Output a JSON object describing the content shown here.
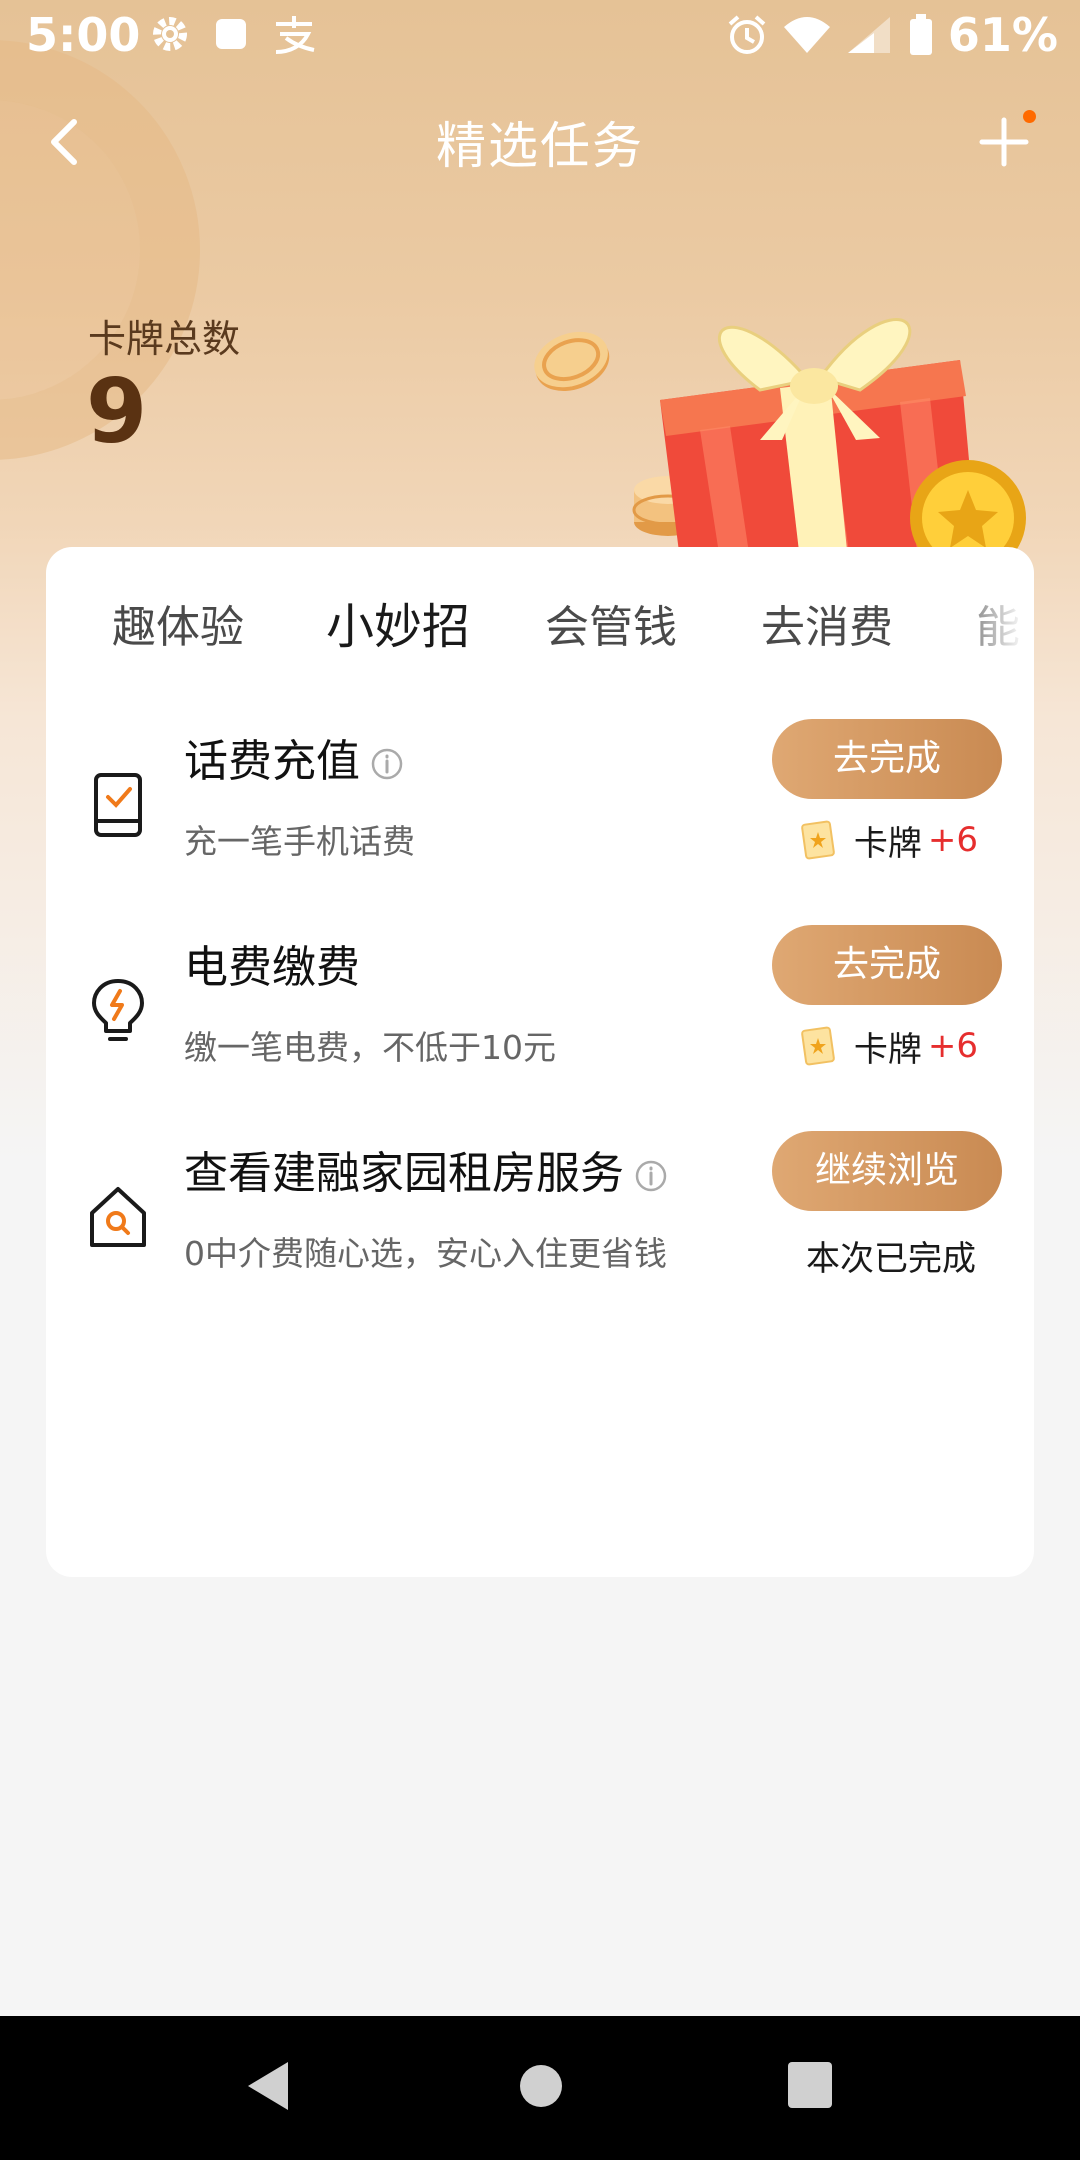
{
  "status": {
    "time": "5:00",
    "battery": "61%",
    "left_icons": [
      "gear-icon",
      "square-notification-icon",
      "alipay-icon"
    ],
    "right_icons": [
      "alarm-icon",
      "wifi-icon",
      "signal-icon",
      "battery-icon"
    ]
  },
  "header": {
    "title": "精选任务",
    "back_icon": "chevron-left-icon",
    "add_icon": "plus-icon"
  },
  "summary": {
    "label": "卡牌总数",
    "value": "9"
  },
  "tabs": [
    {
      "label": "趣体验",
      "active": false
    },
    {
      "label": "小妙招",
      "active": true
    },
    {
      "label": "会管钱",
      "active": false
    },
    {
      "label": "去消费",
      "active": false
    },
    {
      "label": "能",
      "active": false
    }
  ],
  "tasks": [
    {
      "title": "话费充值",
      "has_info": true,
      "desc": "充一笔手机话费",
      "button": "去完成",
      "reward_label": "卡牌",
      "reward_value": "+6",
      "icon": "phone-check-icon"
    },
    {
      "title": "电费缴费",
      "has_info": false,
      "desc": "缴一笔电费，不低于10元",
      "button": "去完成",
      "reward_label": "卡牌",
      "reward_value": "+6",
      "icon": "lightbulb-icon"
    },
    {
      "title": "查看建融家园租房服务",
      "has_info": true,
      "desc": "0中介费随心选，安心入住更省钱",
      "button": "继续浏览",
      "status_text": "本次已完成",
      "icon": "house-search-icon"
    }
  ],
  "colors": {
    "accent_button_start": "#dfa873",
    "accent_button_end": "#c98a52",
    "reward_plus": "#e62e2e",
    "notification_dot": "#ff6a00"
  }
}
